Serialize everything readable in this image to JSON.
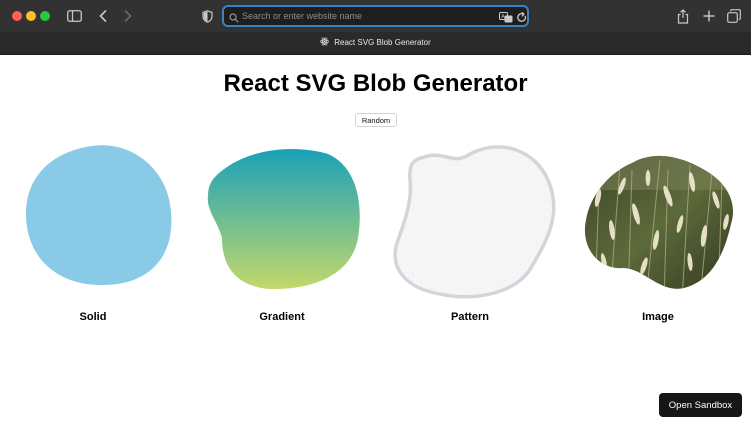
{
  "browser": {
    "url_placeholder": "Search or enter website name",
    "tab_title": "React SVG Blob Generator"
  },
  "page": {
    "title": "React SVG Blob Generator",
    "random_label": "Random",
    "blobs": [
      {
        "label": "Solid"
      },
      {
        "label": "Gradient"
      },
      {
        "label": "Pattern"
      },
      {
        "label": "Image"
      }
    ],
    "sandbox_label": "Open Sandbox"
  },
  "colors": {
    "solid_fill": "#89cbe6",
    "gradient_top": "#1aa1b8",
    "gradient_bottom": "#c3d86a",
    "pattern_stroke": "#d2d6dc",
    "pattern_fill": "#f6f6f6",
    "url_focus": "#3b82c4"
  }
}
